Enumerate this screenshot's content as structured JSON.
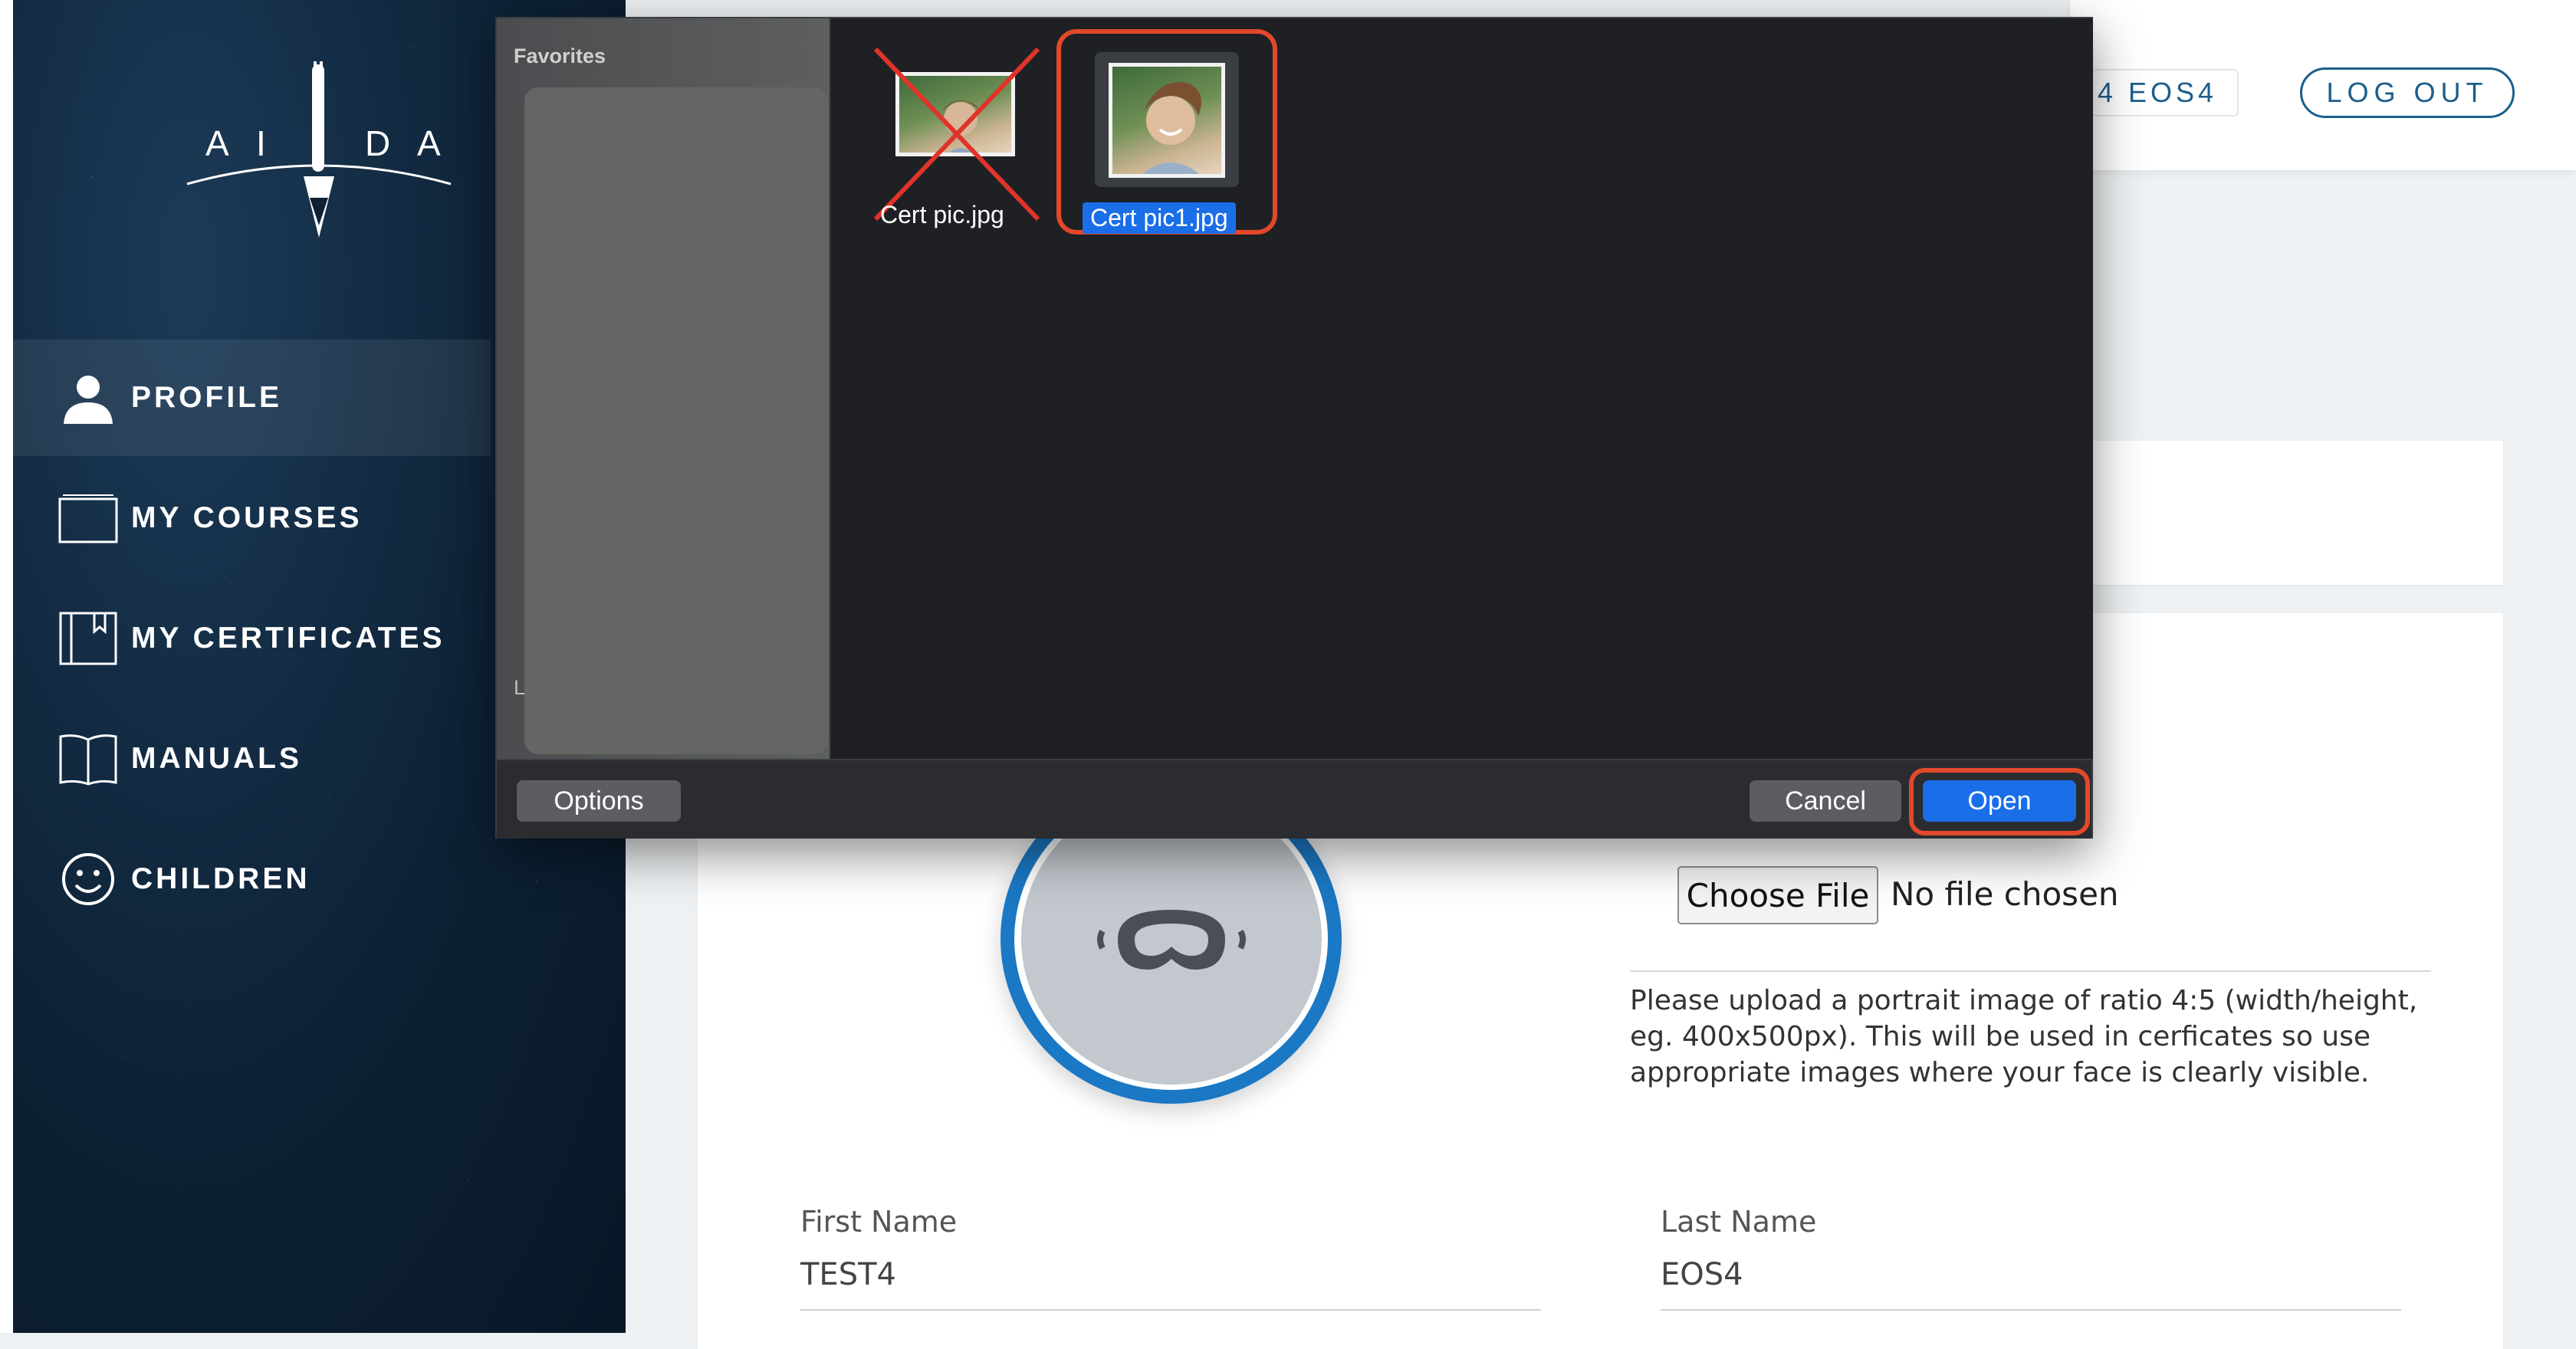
{
  "app": {
    "brand_letters": [
      "A",
      "I",
      "D",
      "A"
    ]
  },
  "header": {
    "user_chip": "4 EOS4",
    "logout_label": "LOG OUT"
  },
  "sidebar": {
    "items": [
      {
        "label": "PROFILE",
        "icon": "person-icon",
        "active": true
      },
      {
        "label": "MY COURSES",
        "icon": "folder-icon",
        "active": false
      },
      {
        "label": "MY CERTIFICATES",
        "icon": "book-bookmark-icon",
        "active": false
      },
      {
        "label": "MANUALS",
        "icon": "open-book-icon",
        "active": false
      },
      {
        "label": "CHILDREN",
        "icon": "smiley-icon",
        "active": false
      }
    ]
  },
  "profile": {
    "choose_file_label": "Choose File",
    "no_file_text": "No file chosen",
    "upload_hint": "Please upload a portrait image of ratio 4:5 (width/height, eg. 400x500px). This will be used in cerficates so use appropriate images where your face is clearly visible.",
    "first_name_label": "First Name",
    "first_name_value": "TEST4",
    "last_name_label": "Last Name",
    "last_name_value": "EOS4",
    "avatar_icon": "vr-goggles-icon"
  },
  "dialog": {
    "sidebar_title": "Favorites",
    "sidebar_partial": "L",
    "files": [
      {
        "name": "Cert pic.jpg",
        "selected": false,
        "crossed_out": true
      },
      {
        "name": "Cert pic1.jpg",
        "selected": true,
        "crossed_out": false
      }
    ],
    "options_label": "Options",
    "cancel_label": "Cancel",
    "open_label": "Open",
    "highlight_color": "#e2482a",
    "accent_color": "#1a6ee8"
  }
}
